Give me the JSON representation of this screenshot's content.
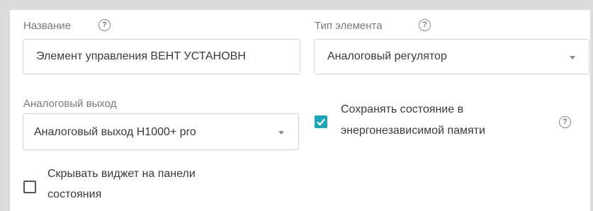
{
  "name_field": {
    "label": "Название",
    "help_icon": "question-circle-icon",
    "value": "Элемент управления ВЕНТ УСТАНОВН"
  },
  "element_type": {
    "label": "Тип элемента",
    "help_icon": "question-circle-icon",
    "selected": "Аналоговый регулятор"
  },
  "analog_output": {
    "label": "Аналоговый выход",
    "selected": "Аналоговый выход H1000+ pro"
  },
  "save_state": {
    "checked": true,
    "line1": "Сохранять состояние в",
    "line2": "энергонезависимой памяти",
    "help_icon": "question-circle-icon"
  },
  "hide_widget": {
    "checked": false,
    "line1": "Скрывать виджет на панели",
    "line2": "состояния"
  },
  "colors": {
    "accent": "#1fa6b8",
    "frame": "#dcdcdc"
  }
}
